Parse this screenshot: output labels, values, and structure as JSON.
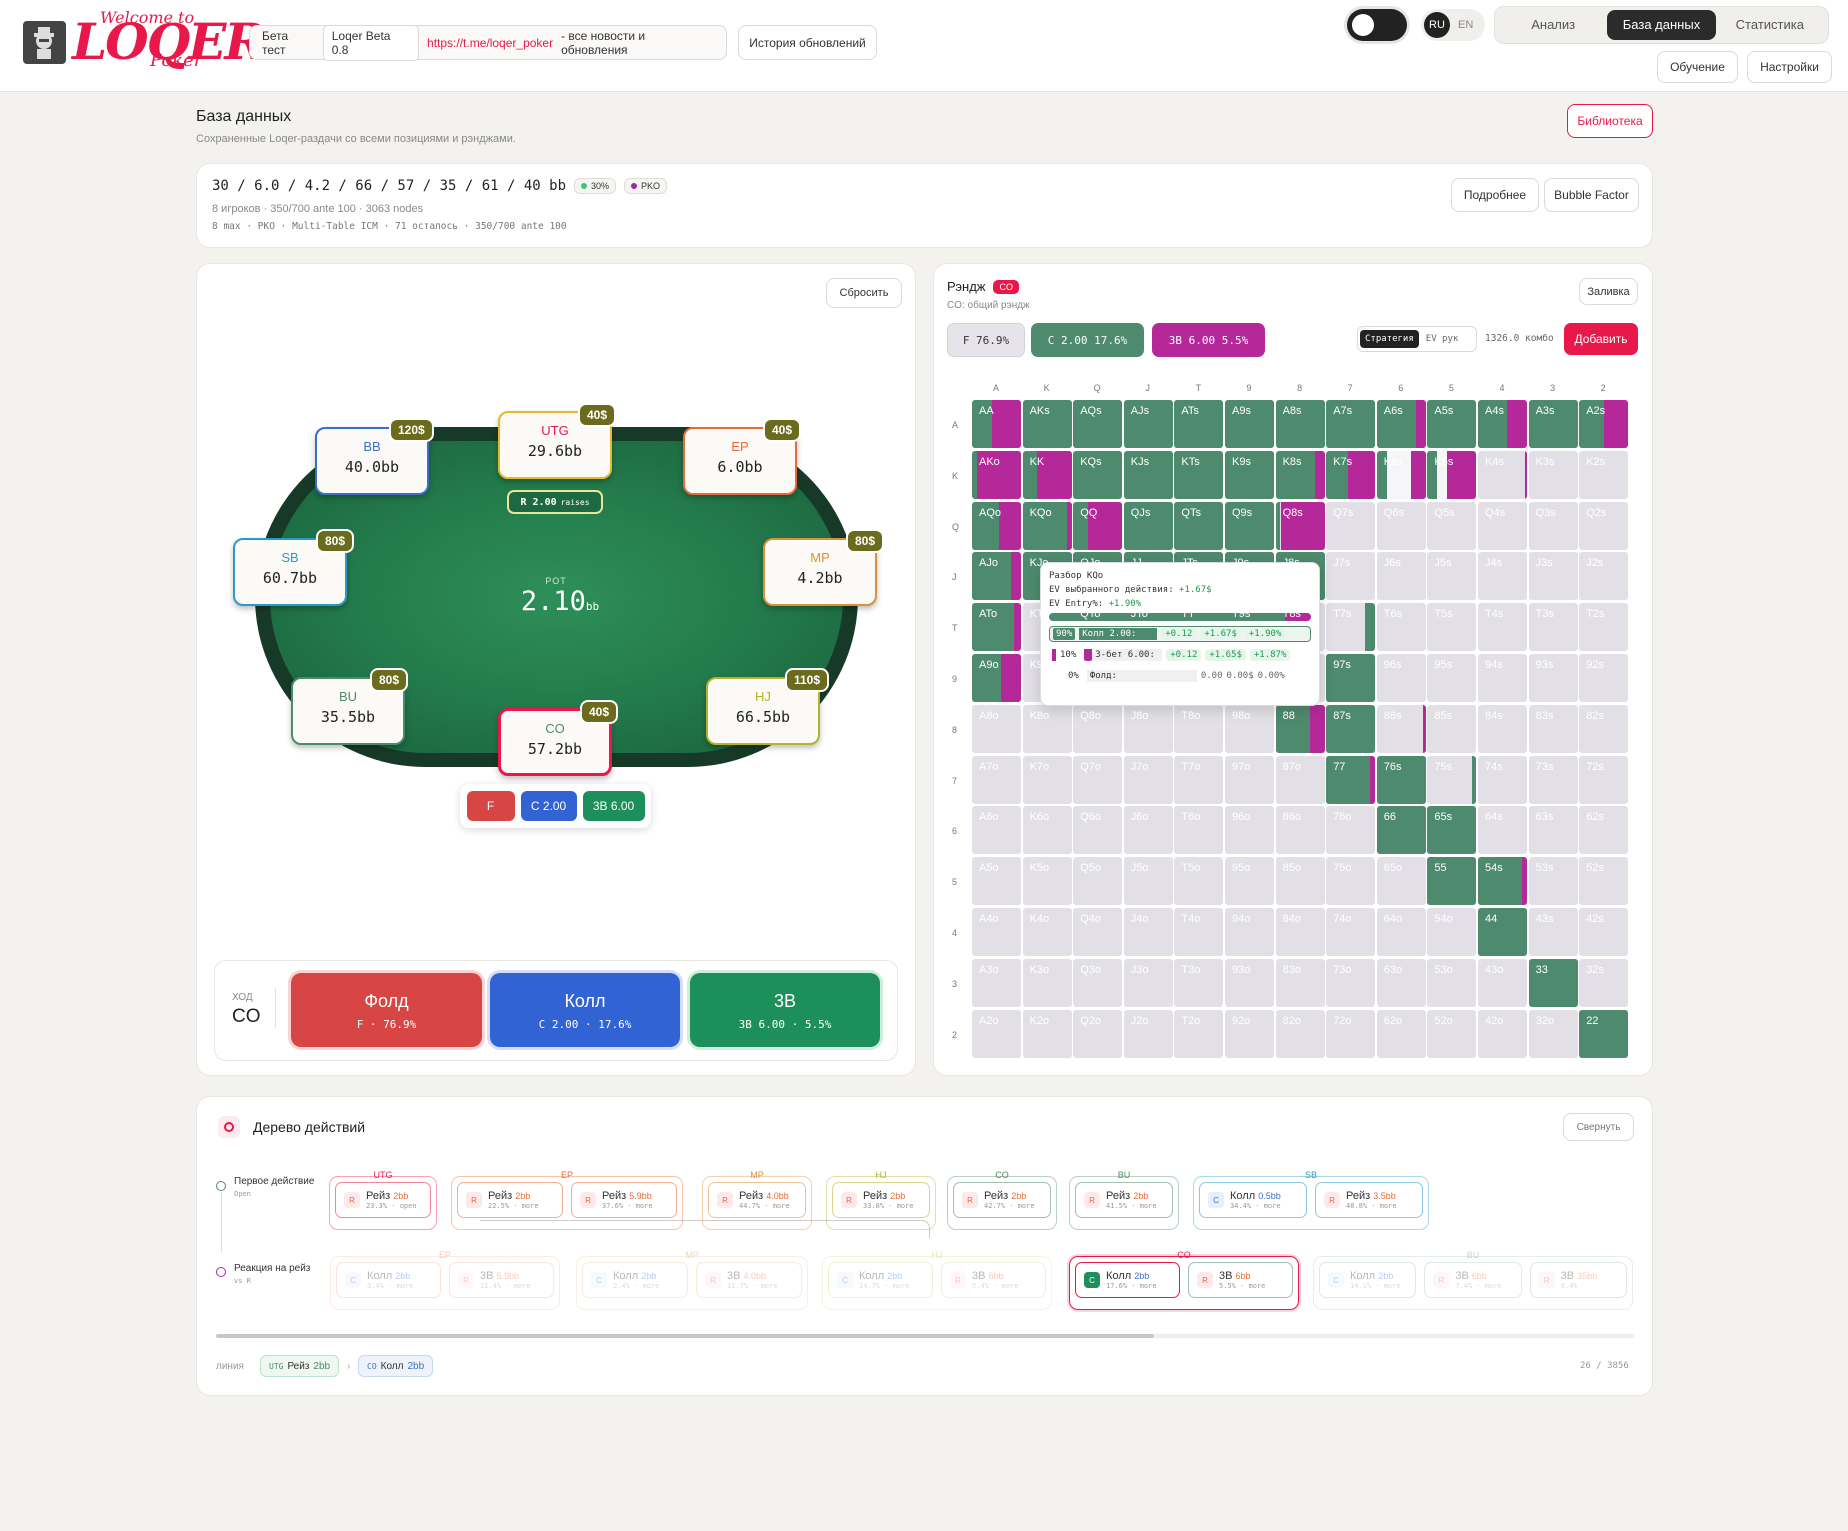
{
  "header": {
    "logo_small": "Welcome to",
    "logo": "LOQER",
    "logo_poker": "Poker",
    "beta_label": "Бета тест",
    "beta_version": "Loqer Beta 0.8",
    "beta_link": "https://t.me/loqer_poker",
    "beta_tail": "- все новости и обновления",
    "history_btn": "История обновлений",
    "lang_on": "RU",
    "lang_off": "EN",
    "tabs": [
      "Анализ",
      "База данных",
      "Статистика"
    ],
    "btn_learn": "Обучение",
    "btn_settings": "Настройки"
  },
  "page": {
    "title": "База данных",
    "subtitle": "Сохраненные Loqer-раздачи со всеми позициями и рэнджами.",
    "library_btn": "Библиотека"
  },
  "summary": {
    "stacks": "30 / 6.0 / 4.2 / 66 / 57 / 35 / 61 / 40 bb",
    "chip1": "30%",
    "chip2": "PKO",
    "line2": "8 игроков · 350/700 ante 100 · 3063 nodes",
    "line3": "8 max · PKO · Multi-Table ICM · 71 осталось · 350/700 ante 100",
    "btn_more": "Подробнее",
    "btn_bubble": "Bubble Factor"
  },
  "table": {
    "reset": "Сбросить",
    "pot_label": "POT",
    "pot_value": "2.10",
    "pot_unit": "bb",
    "raise_badge": "R 2.00",
    "raise_badge_sub": "raises",
    "seats": [
      {
        "pos": "BB",
        "stack": "40.0bb",
        "stake": "120$"
      },
      {
        "pos": "UTG",
        "stack": "29.6bb",
        "stake": "40$"
      },
      {
        "pos": "EP",
        "stack": "6.0bb",
        "stake": "40$"
      },
      {
        "pos": "SB",
        "stack": "60.7bb",
        "stake": "80$"
      },
      {
        "pos": "MP",
        "stack": "4.2bb",
        "stake": "80$"
      },
      {
        "pos": "BU",
        "stack": "35.5bb",
        "stake": "80$"
      },
      {
        "pos": "HJ",
        "stack": "66.5bb",
        "stake": "110$"
      },
      {
        "pos": "CO",
        "stack": "57.2bb",
        "stake": "40$"
      }
    ],
    "mini_actions": [
      "F",
      "C 2.00",
      "3B 6.00"
    ],
    "turn_label": "ХОД",
    "turn_pos": "CO",
    "actions": [
      {
        "title": "Фолд",
        "sub": "F · 76.9%"
      },
      {
        "title": "Колл",
        "sub": "C 2.00 · 17.6%"
      },
      {
        "title": "3B",
        "sub": "3B 6.00 · 5.5%"
      }
    ]
  },
  "range": {
    "title": "Рэндж",
    "pos_badge": "CO",
    "sub": "CO: общий рэндж",
    "fill_btn": "Заливка",
    "f_chip": "F 76.9%",
    "c_chip": "C 2.00 17.6%",
    "b_chip": "3B 6.00 5.5%",
    "mode_on": "Стратегия",
    "mode_off": "EV рук",
    "combos": "1326.0 комбо",
    "add_btn": "Добавить",
    "cols": [
      "A",
      "K",
      "Q",
      "J",
      "T",
      "9",
      "8",
      "7",
      "6",
      "5",
      "4",
      "3",
      "2"
    ],
    "colors": {
      "call": "#4e8a6d",
      "raise": "#b5289a",
      "fold": "#e2e0e6"
    },
    "tooltip": {
      "title": "Разбор KQo",
      "ev1_label": "EV выбранного действия:",
      "ev1": "+1.67$",
      "ev2_label": "EV Entry%:",
      "ev2": "+1.90%",
      "r1_pct": "90%",
      "r1_name": "Колл 2.00:",
      "r1_a": "+0.12",
      "r1_b": "+1.67$",
      "r1_c": "+1.90%",
      "r2_pct": "10%",
      "r2_name": "3-бет 6.00:",
      "r2_a": "+0.12",
      "r2_b": "+1.65$",
      "r2_c": "+1.87%",
      "r3_pct": "0%",
      "r3_name": "Фолд:",
      "r3_a": "0.00",
      "r3_b": "0.00$",
      "r3_c": "0.00%"
    }
  },
  "tree": {
    "title": "Дерево действий",
    "collapse": "Свернуть",
    "first": "Первое действие",
    "first_sub": "Open",
    "react": "Реакция на рейз",
    "react_sub": "vs R",
    "row1": [
      {
        "g": "UTG",
        "n": [
          {
            "i": "R",
            "t": "Рейз",
            "v": "2bb",
            "s": "23.3% · open"
          }
        ]
      },
      {
        "g": "EP",
        "n": [
          {
            "i": "R",
            "t": "Рейз",
            "v": "2bb",
            "s": "22.5% · more"
          },
          {
            "i": "R",
            "t": "Рейз",
            "v": "5.9bb",
            "s": "37.6% · more"
          }
        ]
      },
      {
        "g": "MP",
        "n": [
          {
            "i": "R",
            "t": "Рейз",
            "v": "4.0bb",
            "s": "44.7% · more"
          }
        ]
      },
      {
        "g": "HJ",
        "n": [
          {
            "i": "R",
            "t": "Рейз",
            "v": "2bb",
            "s": "33.8% · more"
          }
        ]
      },
      {
        "g": "CO",
        "n": [
          {
            "i": "R",
            "t": "Рейз",
            "v": "2bb",
            "s": "42.7% · more"
          }
        ]
      },
      {
        "g": "BU",
        "n": [
          {
            "i": "R",
            "t": "Рейз",
            "v": "2bb",
            "s": "41.5% · more"
          }
        ]
      },
      {
        "g": "SB",
        "n": [
          {
            "i": "C",
            "t": "Колл",
            "v": "0.5bb",
            "s": "34.4% · more"
          },
          {
            "i": "R",
            "t": "Рейз",
            "v": "3.5bb",
            "s": "48.8% · more"
          }
        ]
      }
    ],
    "row2": [
      {
        "g": "EP",
        "n": [
          {
            "i": "C",
            "t": "Колл",
            "v": "2bb",
            "s": "3.4% · more"
          },
          {
            "i": "R",
            "t": "3B",
            "v": "5.9bb",
            "s": "11.4% · more"
          }
        ]
      },
      {
        "g": "MP",
        "n": [
          {
            "i": "C",
            "t": "Колл",
            "v": "2bb",
            "s": "2.4% · more"
          },
          {
            "i": "R",
            "t": "3B",
            "v": "4.0bb",
            "s": "11.7% · more"
          }
        ]
      },
      {
        "g": "HJ",
        "n": [
          {
            "i": "C",
            "t": "Колл",
            "v": "2bb",
            "s": "14.7% · more"
          },
          {
            "i": "R",
            "t": "3B",
            "v": "6bb",
            "s": "5.4% · more"
          }
        ]
      },
      {
        "g": "CO",
        "n": [
          {
            "i": "C",
            "t": "Колл",
            "v": "2bb",
            "s": "17.6% · more"
          },
          {
            "i": "R",
            "t": "3B",
            "v": "6bb",
            "s": "5.5% · more"
          }
        ]
      },
      {
        "g": "BU",
        "n": [
          {
            "i": "C",
            "t": "Колл",
            "v": "2bb",
            "s": "14.1% · more"
          },
          {
            "i": "R",
            "t": "3B",
            "v": "6bb",
            "s": "7.4% · more"
          },
          {
            "i": "R",
            "t": "3B",
            "v": "35bb",
            "s": "0.4%"
          }
        ]
      }
    ],
    "line_label": "линия",
    "line1_pos": "UTG",
    "line1_act": "Рейз",
    "line1_val": "2bb",
    "line2_pos": "CO",
    "line2_act": "Колл",
    "line2_val": "2bb",
    "count": "26 / 3856"
  }
}
